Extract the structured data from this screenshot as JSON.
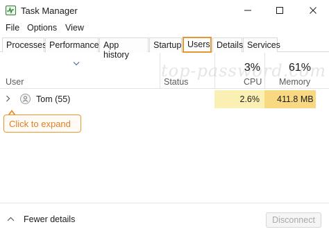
{
  "window": {
    "title": "Task Manager",
    "icon": "task-manager-icon",
    "controls": [
      "minimize-icon",
      "maximize-icon",
      "close-icon"
    ]
  },
  "menu": [
    "File",
    "Options",
    "View"
  ],
  "tabs": [
    {
      "label": "Processes",
      "active": false
    },
    {
      "label": "Performance",
      "active": false
    },
    {
      "label": "App history",
      "active": false
    },
    {
      "label": "Startup",
      "active": false
    },
    {
      "label": "Users",
      "active": true
    },
    {
      "label": "Details",
      "active": false
    },
    {
      "label": "Services",
      "active": false
    }
  ],
  "columns": {
    "user": "User",
    "status": "Status",
    "cpu": {
      "label": "CPU",
      "percent": "3%"
    },
    "memory": {
      "label": "Memory",
      "percent": "61%"
    }
  },
  "watermark": "top-password.com",
  "rows": [
    {
      "name": "Tom (55)",
      "status": "",
      "cpu": "2.6%",
      "memory": "411.8 MB"
    }
  ],
  "callout": "Click to expand",
  "footer": {
    "fewer_details": "Fewer details",
    "disconnect": "Disconnect"
  },
  "colors": {
    "accent": "#e8962f",
    "cpu_cell": "#fbf0b4",
    "memory_cell": "#f8d982"
  }
}
